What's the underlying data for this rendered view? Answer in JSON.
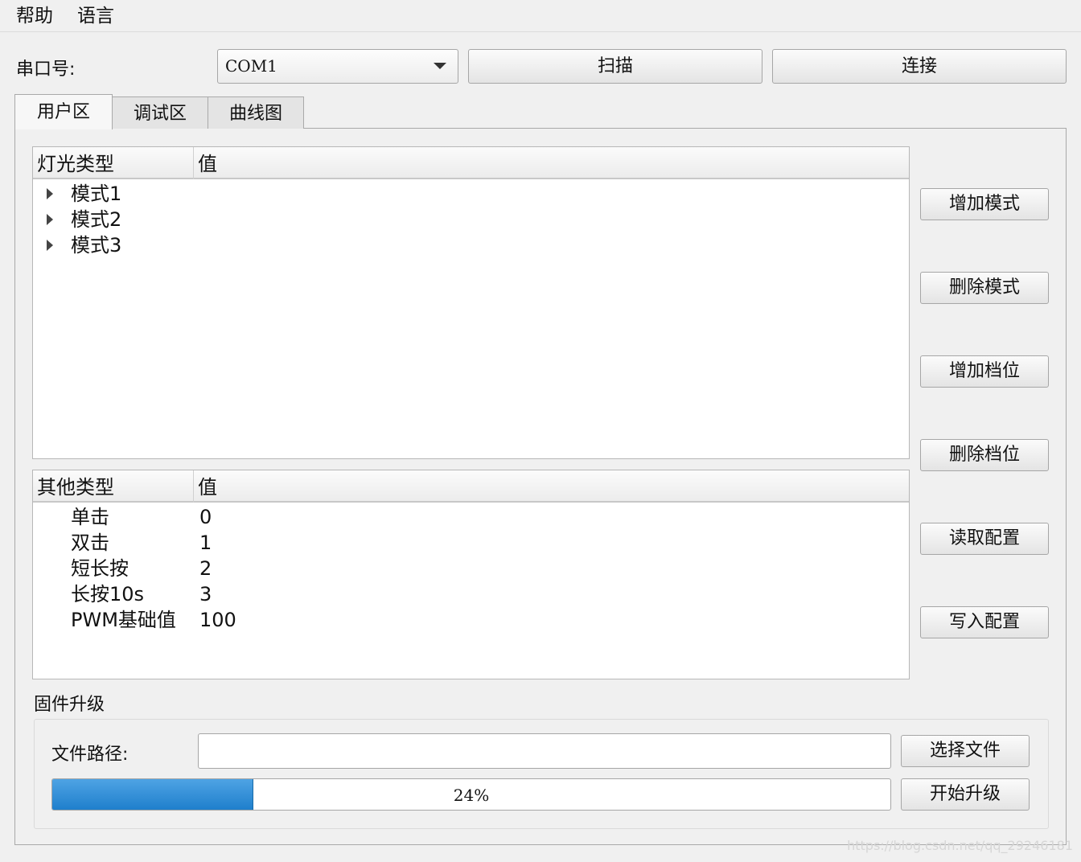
{
  "menu": {
    "help": "帮助",
    "language": "语言"
  },
  "serial": {
    "label": "串口号:",
    "selected_port": "COM1",
    "scan_label": "扫描",
    "connect_label": "连接"
  },
  "tabs": [
    {
      "label": "用户区",
      "active": true
    },
    {
      "label": "调试区",
      "active": false
    },
    {
      "label": "曲线图",
      "active": false
    }
  ],
  "light_tree": {
    "headers": [
      "灯光类型",
      "值"
    ],
    "items": [
      {
        "label": "模式1",
        "expandable": true
      },
      {
        "label": "模式2",
        "expandable": true
      },
      {
        "label": "模式3",
        "expandable": true
      }
    ]
  },
  "other_tree": {
    "headers": [
      "其他类型",
      "值"
    ],
    "rows": [
      {
        "name": "单击",
        "value": "0"
      },
      {
        "name": "双击",
        "value": "1"
      },
      {
        "name": "短长按",
        "value": "2"
      },
      {
        "name": "长按10s",
        "value": "3"
      },
      {
        "name": "PWM基础值",
        "value": "100"
      }
    ]
  },
  "side_buttons": {
    "add_mode": "增加模式",
    "delete_mode": "删除模式",
    "add_level": "增加档位",
    "delete_level": "删除档位",
    "read_config": "读取配置",
    "write_config": "写入配置"
  },
  "firmware": {
    "group_title": "固件升级",
    "file_path_label": "文件路径:",
    "file_path_value": "",
    "choose_file_label": "选择文件",
    "start_upgrade_label": "开始升级",
    "progress_percent": 24,
    "progress_text": "24%"
  },
  "colors": {
    "progress_fill": "#2b8ad6",
    "window_bg": "#f0f0f0"
  },
  "watermark": "https://blog.csdn.net/qq_29246181"
}
